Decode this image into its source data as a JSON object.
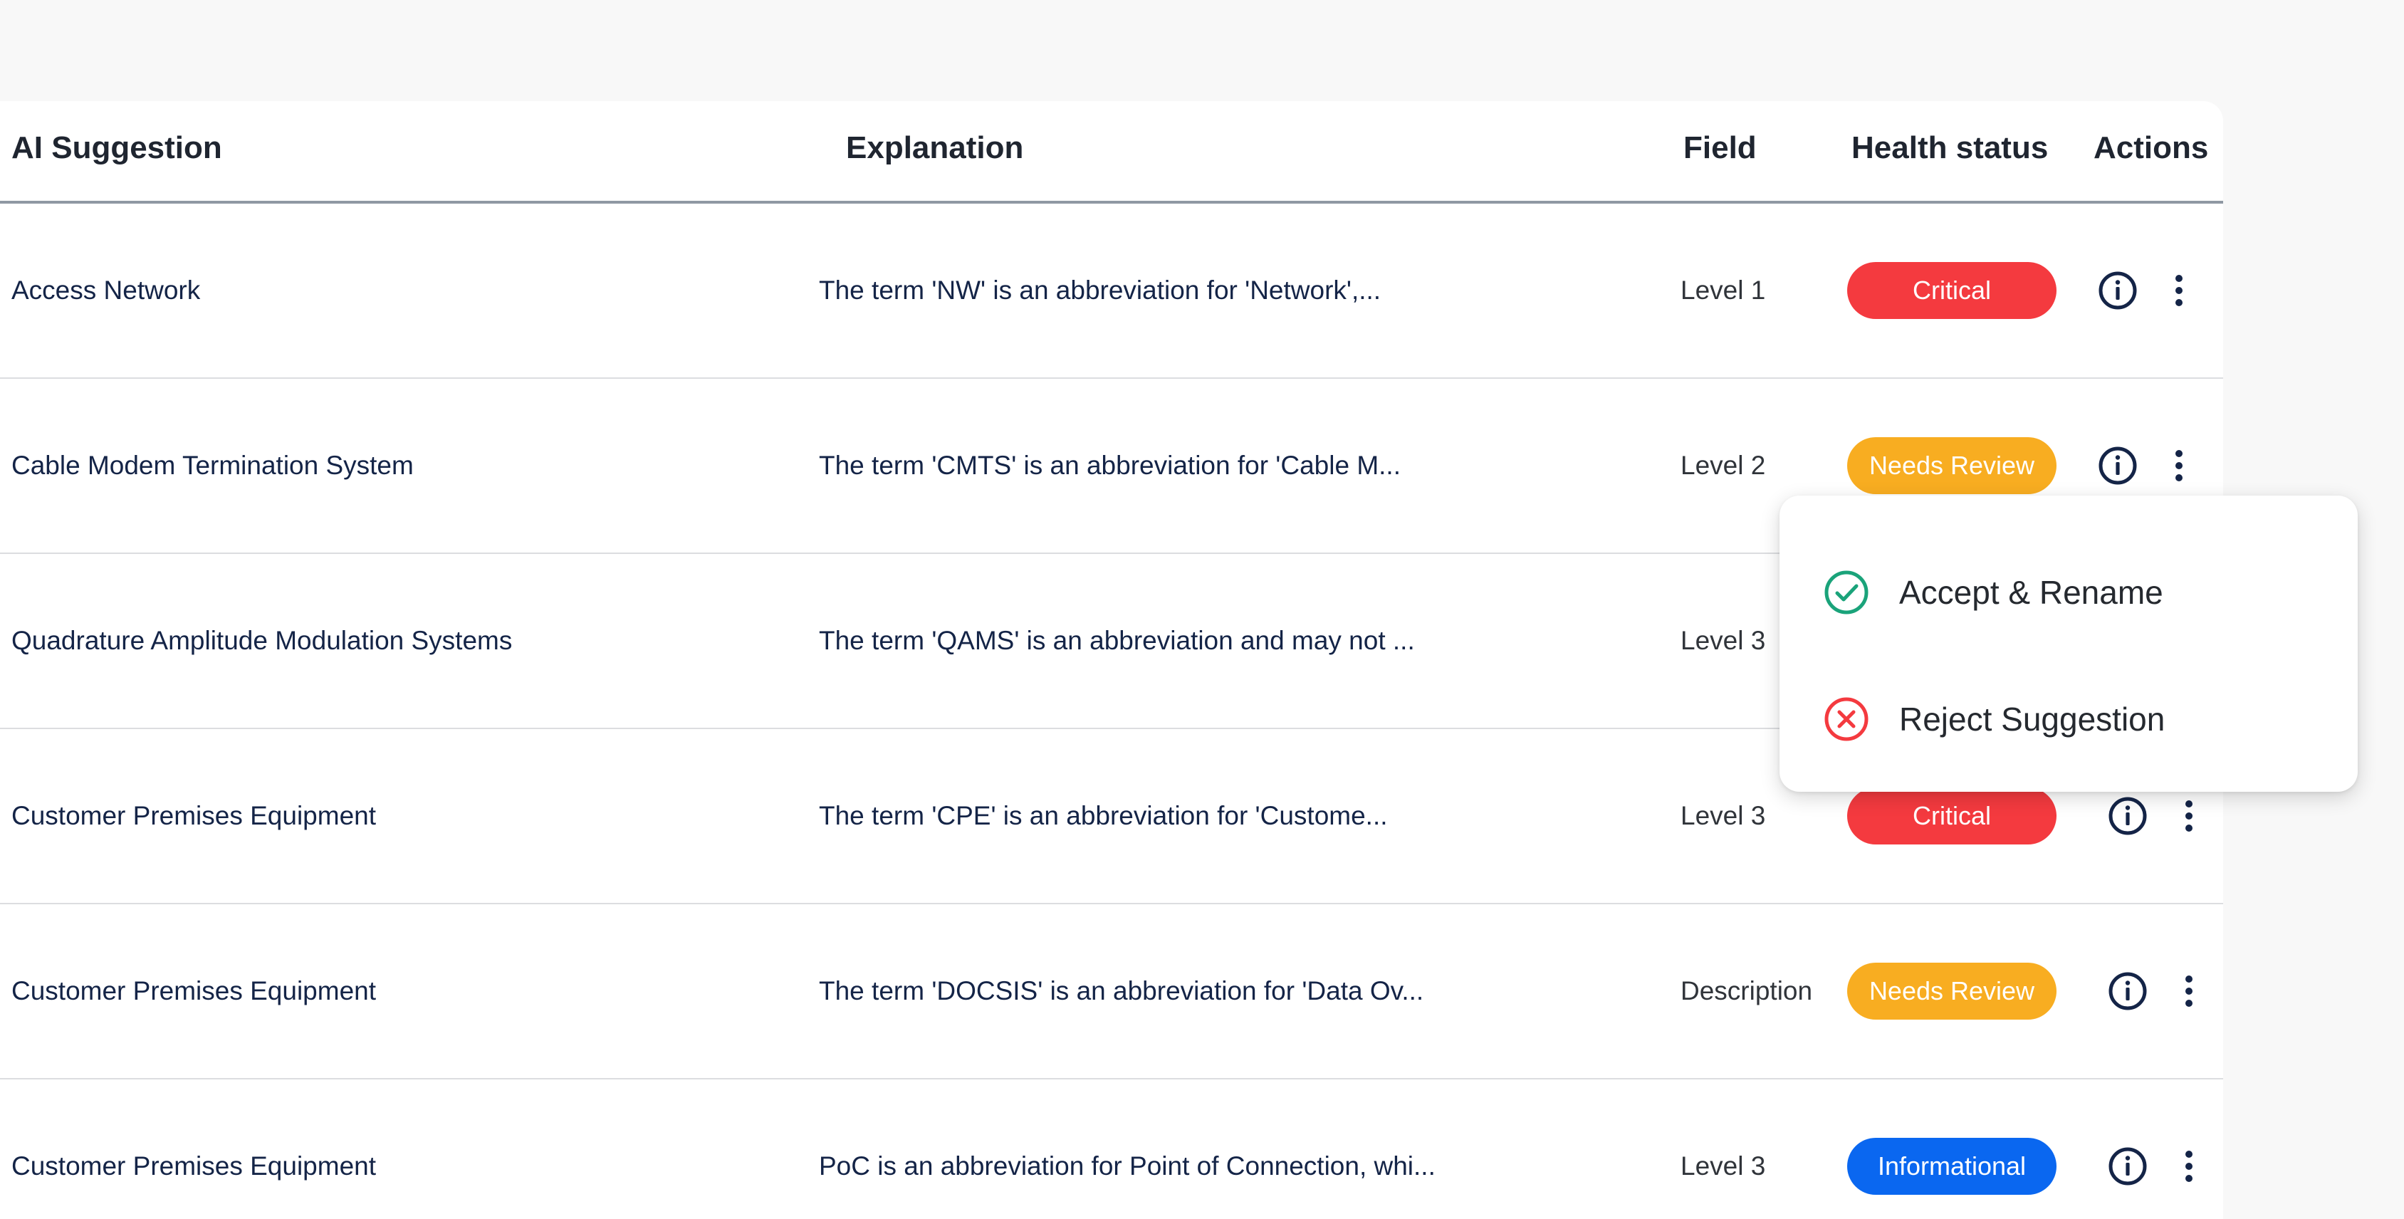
{
  "table": {
    "headers": {
      "suggestion": "AI Suggestion",
      "explanation": "Explanation",
      "field": "Field",
      "health": "Health status",
      "actions": "Actions"
    },
    "rows": [
      {
        "suggestion": "Access Network",
        "explanation": "The term 'NW' is an abbreviation for 'Network',...",
        "field": "Level 1",
        "status": "Critical"
      },
      {
        "suggestion": "Cable Modem Termination System",
        "explanation": "The term 'CMTS' is an abbreviation for 'Cable M...",
        "field": "Level 2",
        "status": "Needs Review"
      },
      {
        "suggestion": "Quadrature Amplitude Modulation Systems",
        "explanation": "The term 'QAMS' is an abbreviation and may not ...",
        "field": "Level 3",
        "status": ""
      },
      {
        "suggestion": "Customer Premises Equipment",
        "explanation": "The term 'CPE' is an abbreviation for 'Custome...",
        "field": "Level 3",
        "status": "Critical"
      },
      {
        "suggestion": "Customer Premises Equipment",
        "explanation": "The term 'DOCSIS' is an abbreviation for 'Data Ov...",
        "field": "Description",
        "status": "Needs Review"
      },
      {
        "suggestion": "Customer Premises Equipment",
        "explanation": "PoC is an abbreviation for Point of Connection, whi...",
        "field": "Level 3",
        "status": "Informational"
      }
    ]
  },
  "action_menu": {
    "accept_label": "Accept & Rename",
    "reject_label": "Reject Suggestion",
    "accept_icon": "check-circle-icon",
    "reject_icon": "x-circle-icon"
  },
  "colors": {
    "critical": "#f43a3f",
    "needs_review": "#f8ad21",
    "informational": "#0a67f0",
    "accept": "#1aa37a",
    "reject": "#f43a3f"
  }
}
